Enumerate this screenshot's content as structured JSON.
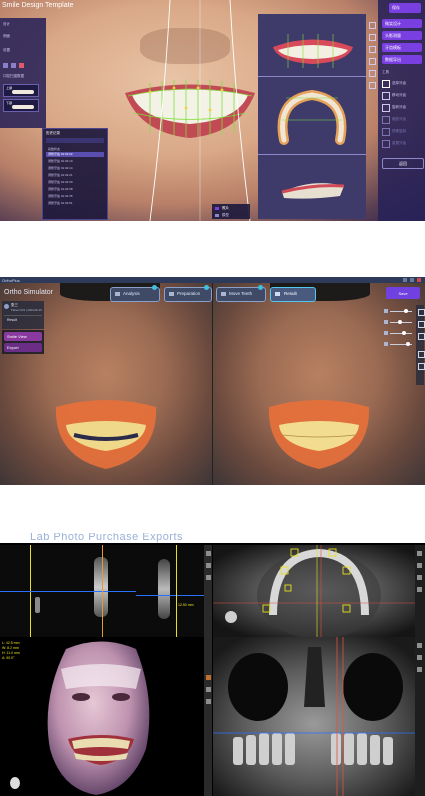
{
  "panel1": {
    "app_title": "Smile Design Template",
    "top_right_button": "保存",
    "left_rows": [
      "设计",
      "侧面",
      "设置"
    ],
    "left_small_label": "口腔扫描数据",
    "chip_labels": [
      "上颌",
      "下颌"
    ],
    "history_title": "历史记录",
    "history_rows": [
      "初始状态",
      "调整牙齿 01:32:02",
      "调整牙齿 01:32:10",
      "调整牙齿 01:32:14",
      "调整牙齿 01:32:21",
      "调整牙齿 01:32:30",
      "调整牙齿 01:32:38",
      "调整牙齿 01:32:45",
      "调整牙齿 01:32:51"
    ],
    "right_buttons": [
      "微笑设计",
      "头影测量",
      "牙齿模板",
      "数据导出"
    ],
    "right_section_label": "工具",
    "right_tools": [
      "选择牙齿",
      "移动牙齿",
      "旋转牙齿",
      "缩放牙齿",
      "镜像复制",
      "重置牙齿"
    ],
    "right_bottom_button": "返回",
    "bottom_chips": [
      "照片",
      "模型"
    ]
  },
  "panel2": {
    "app_title": "Ortho Simulator",
    "window_label": "OrthoPlus",
    "tabs": [
      "Analysis",
      "Preparation",
      "Move Teeth",
      "Result"
    ],
    "top_right_button": "Save",
    "left_patient": "张三",
    "left_patient_sub": "Patient 001 | 2023-06-15",
    "left_menu": "Result",
    "left_buttons": [
      "Smile View",
      "Export"
    ]
  },
  "panel3": {
    "overlay_text": "Lab Photo  Purchase Exports",
    "left_readout": [
      "L: 42.5 mm",
      "W: 8.2 mm",
      "H: 11.0 mm",
      "A: 90.0°"
    ],
    "slice_value": "12.50 mm",
    "colors": {
      "crosshair_blue": "#2b6fff",
      "crosshair_orange": "#e89a30",
      "marker_yellow": "#e8e020",
      "crosshair_red": "#e05040"
    }
  }
}
